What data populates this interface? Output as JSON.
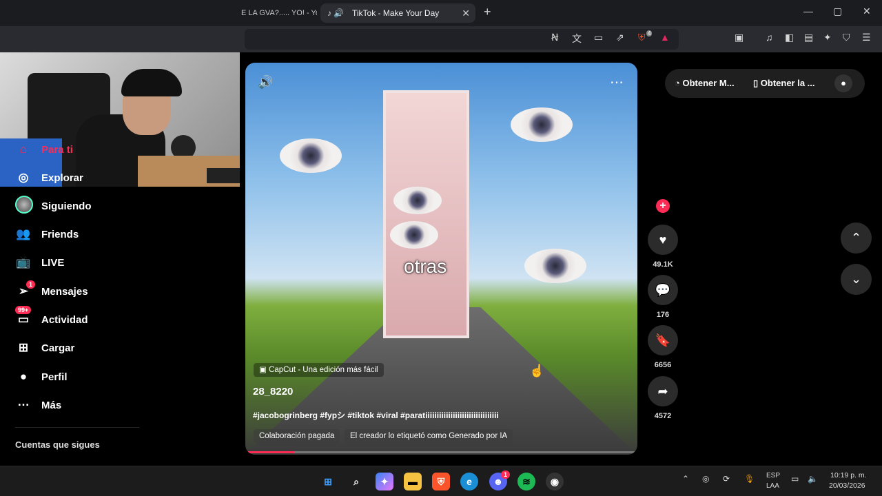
{
  "browser": {
    "prev_tab_title": "E LA GVA?..... YO! - Yo",
    "active_tab_title": "TikTok - Make Your Day",
    "new_tab": "+",
    "close_tab": "✕",
    "window_controls": [
      "—",
      "▢",
      "✕"
    ],
    "toolbar_icons": [
      "no-audio-icon",
      "translate-icon",
      "cast-icon",
      "share-icon",
      "brave-shield-icon",
      "brave-rewards-icon",
      "reader-icon",
      "media-icon",
      "sidebar-icon",
      "wallet-icon",
      "leo-icon",
      "vpn-icon",
      "menu-icon"
    ],
    "shield_count": "4"
  },
  "sidebar": {
    "items": [
      {
        "label": "Para ti",
        "icon": "home-icon"
      },
      {
        "label": "Explorar",
        "icon": "compass-icon"
      },
      {
        "label": "Siguiendo",
        "icon": "following-avatar"
      },
      {
        "label": "Friends",
        "icon": "friends-icon"
      },
      {
        "label": "LIVE",
        "icon": "live-icon"
      },
      {
        "label": "Mensajes",
        "icon": "messages-icon",
        "badge": "1"
      },
      {
        "label": "Actividad",
        "icon": "activity-icon",
        "badge": "99+"
      },
      {
        "label": "Cargar",
        "icon": "upload-icon"
      },
      {
        "label": "Perfil",
        "icon": "profile-icon"
      },
      {
        "label": "Más",
        "icon": "more-icon"
      }
    ],
    "following_title": "Cuentas que sigues"
  },
  "video": {
    "overlay_text": "otras",
    "capcut_label": "CapCut - Una edición más fácil",
    "author": "28_8220",
    "caption": "#jacobogrinberg #fypシ #tiktok #viral #paratiiiiiiiiiiiiiiiiiiiiiiiiiiiiiiii",
    "chips": [
      "Colaboración pagada",
      "El creador lo etiquetó como Generado por IA"
    ],
    "progress": 0.12
  },
  "actions": {
    "likes": "49.1K",
    "comments": "176",
    "saves": "6656",
    "shares": "4572"
  },
  "right_panel": {
    "get_app_label": "Obtener M...",
    "get_phone_label": "Obtener la ..."
  },
  "taskbar": {
    "apps": [
      "windows-start-icon",
      "search-icon",
      "copilot-icon",
      "file-explorer-icon",
      "brave-icon",
      "edge-icon",
      "discord-icon",
      "spotify-icon",
      "obs-icon"
    ],
    "discord_badge": "1",
    "lang_top": "ESP",
    "lang_bottom": "LAA",
    "time": "10:19 p. m.",
    "date": "20/03/2026"
  },
  "colors": {
    "accent": "#fe2c55",
    "background": "#000000"
  }
}
